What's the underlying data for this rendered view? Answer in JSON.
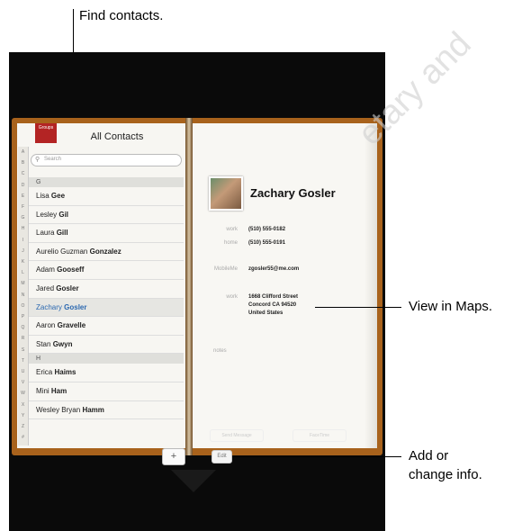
{
  "callouts": {
    "find": "Find contacts.",
    "maps": "View in Maps.",
    "add1": "Add or",
    "add2": "change info."
  },
  "left_page": {
    "groups_button": "Groups",
    "title": "All Contacts",
    "search_placeholder": "Search",
    "index_letters": [
      "A",
      "B",
      "C",
      "D",
      "E",
      "F",
      "G",
      "H",
      "I",
      "J",
      "K",
      "L",
      "M",
      "N",
      "O",
      "P",
      "Q",
      "R",
      "S",
      "T",
      "U",
      "V",
      "W",
      "X",
      "Y",
      "Z",
      "#"
    ],
    "sections": [
      {
        "header": "G",
        "contacts": [
          {
            "first": "Lisa",
            "last": "Gee",
            "selected": false
          },
          {
            "first": "Lesley",
            "last": "Gil",
            "selected": false
          },
          {
            "first": "Laura",
            "last": "Gill",
            "selected": false
          },
          {
            "first": "Aurelio Guzman",
            "last": "Gonzalez",
            "selected": false
          },
          {
            "first": "Adam",
            "last": "Gooseff",
            "selected": false
          },
          {
            "first": "Jared",
            "last": "Gosler",
            "selected": false
          },
          {
            "first": "Zachary",
            "last": "Gosler",
            "selected": true
          },
          {
            "first": "Aaron",
            "last": "Gravelle",
            "selected": false
          },
          {
            "first": "Stan",
            "last": "Gwyn",
            "selected": false
          }
        ]
      },
      {
        "header": "H",
        "contacts": [
          {
            "first": "Erica",
            "last": "Haims",
            "selected": false
          },
          {
            "first": "Mini",
            "last": "Ham",
            "selected": false
          },
          {
            "first": "Wesley Bryan",
            "last": "Hamm",
            "selected": false
          }
        ]
      }
    ],
    "add_button": "+"
  },
  "right_page": {
    "name": "Zachary Gosler",
    "fields": [
      {
        "label": "work",
        "value": "(510) 555-0182"
      },
      {
        "label": "home",
        "value": "(510) 555-0191"
      },
      {
        "label": "MobileMe",
        "value": "zgosler55@me.com"
      }
    ],
    "address": {
      "label": "work",
      "line1": "1668 Clifford Street",
      "line2": "Concord CA 94520",
      "line3": "United States"
    },
    "notes_label": "notes",
    "send_message": "Send Message",
    "facetime": "FaceTime",
    "edit_button": "Edit"
  },
  "watermark": "etary and"
}
